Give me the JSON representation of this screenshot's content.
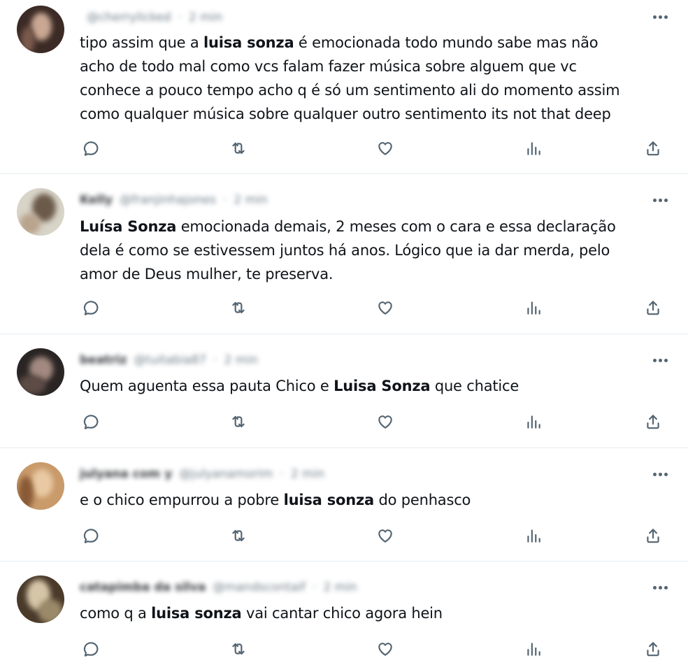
{
  "tweets": [
    {
      "name": "",
      "handle": "@cherrylicked",
      "time": "2 min",
      "text_segments": [
        {
          "t": "tipo assim que a ",
          "b": false
        },
        {
          "t": "luisa sonza",
          "b": true
        },
        {
          "t": " é emocionada todo mundo sabe mas não\nacho de todo mal como vcs falam fazer música sobre alguem que vc\nconhece a pouco tempo acho q é só um sentimento ali do momento assim\ncomo qualquer música sobre qualquer outro sentimento its not that deep",
          "b": false
        }
      ],
      "avatar_colors": [
        "#3b2a25",
        "#7a5a4c",
        "#c9a793"
      ]
    },
    {
      "name": "Kelly",
      "handle": "@franjinhajones",
      "time": "2 min",
      "text_segments": [
        {
          "t": "Luísa Sonza",
          "b": true
        },
        {
          "t": " emocionada demais, 2 meses com o cara e essa declaração\ndela é como se estivessem juntos há anos. Lógico que ia dar merda, pelo\namor de Deus mulher, te preserva.",
          "b": false
        }
      ],
      "avatar_colors": [
        "#d8d4c8",
        "#6b5a4a",
        "#b9a48d"
      ]
    },
    {
      "name": "beatriz",
      "handle": "@tuitabia87",
      "time": "2 min",
      "text_segments": [
        {
          "t": "Quem aguenta essa pauta Chico e ",
          "b": false
        },
        {
          "t": "Luisa Sonza",
          "b": true
        },
        {
          "t": " que chatice",
          "b": false
        }
      ],
      "avatar_colors": [
        "#2a2524",
        "#5d4b46",
        "#a38a80"
      ]
    },
    {
      "name": "julyana com y",
      "handle": "@julyanamorim",
      "time": "2 min",
      "text_segments": [
        {
          "t": "e o chico empurrou a pobre ",
          "b": false
        },
        {
          "t": "luisa sonza",
          "b": true
        },
        {
          "t": " do penhasco",
          "b": false
        }
      ],
      "avatar_colors": [
        "#c99a6a",
        "#8a5a36",
        "#e8c9a3"
      ]
    },
    {
      "name": "catapimba da silva",
      "handle": "@mandscontaif",
      "time": "2 min",
      "text_segments": [
        {
          "t": "como q a ",
          "b": false
        },
        {
          "t": "luisa sonza",
          "b": true
        },
        {
          "t": " vai cantar chico agora hein",
          "b": false
        }
      ],
      "avatar_colors": [
        "#4a3a2a",
        "#9a8a6a",
        "#d6c6a8"
      ]
    }
  ],
  "icons": {
    "reply": "reply-icon",
    "retweet": "retweet-icon",
    "like": "like-icon",
    "views": "views-icon",
    "share": "share-icon",
    "more": "more-icon"
  },
  "colors": {
    "text": "#0f1419",
    "secondary": "#536471",
    "divider": "#e6ecf0"
  }
}
